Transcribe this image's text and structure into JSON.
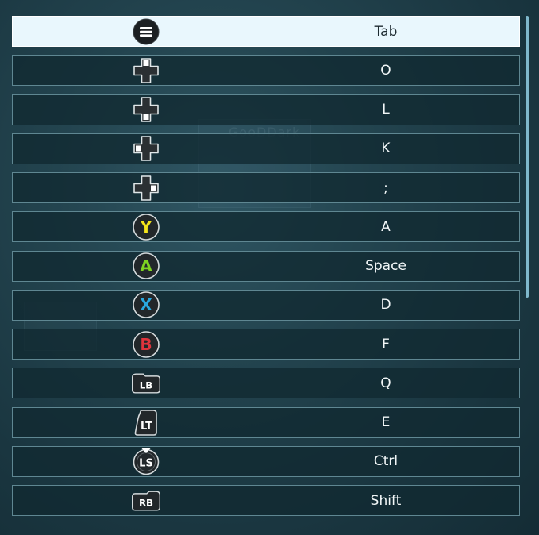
{
  "background": {
    "watermark_text": "GooDDark"
  },
  "colors": {
    "row_selected_bg": "#e9f7fd",
    "row_bg": "#112931",
    "row_border": "#5f8792",
    "button_y": "#f4e41b",
    "button_a": "#7ed321",
    "button_x": "#29a8e0",
    "button_b": "#e0343c",
    "scrollbar": "#7fb8cc"
  },
  "bindings": [
    {
      "icon": "menu-icon",
      "button_label": "",
      "key": "Tab",
      "selected": true
    },
    {
      "icon": "dpad-up-icon",
      "button_label": "",
      "key": "O",
      "selected": false
    },
    {
      "icon": "dpad-down-icon",
      "button_label": "",
      "key": "L",
      "selected": false
    },
    {
      "icon": "dpad-left-icon",
      "button_label": "",
      "key": "K",
      "selected": false
    },
    {
      "icon": "dpad-right-icon",
      "button_label": "",
      "key": ";",
      "selected": false
    },
    {
      "icon": "y-button-icon",
      "button_label": "Y",
      "key": "A",
      "selected": false
    },
    {
      "icon": "a-button-icon",
      "button_label": "A",
      "key": "Space",
      "selected": false
    },
    {
      "icon": "x-button-icon",
      "button_label": "X",
      "key": "D",
      "selected": false
    },
    {
      "icon": "b-button-icon",
      "button_label": "B",
      "key": "F",
      "selected": false
    },
    {
      "icon": "lb-bumper-icon",
      "button_label": "LB",
      "key": "Q",
      "selected": false
    },
    {
      "icon": "lt-trigger-icon",
      "button_label": "LT",
      "key": "E",
      "selected": false
    },
    {
      "icon": "ls-stick-icon",
      "button_label": "LS",
      "key": "Ctrl",
      "selected": false
    },
    {
      "icon": "rb-bumper-icon",
      "button_label": "RB",
      "key": "Shift",
      "selected": false
    }
  ]
}
